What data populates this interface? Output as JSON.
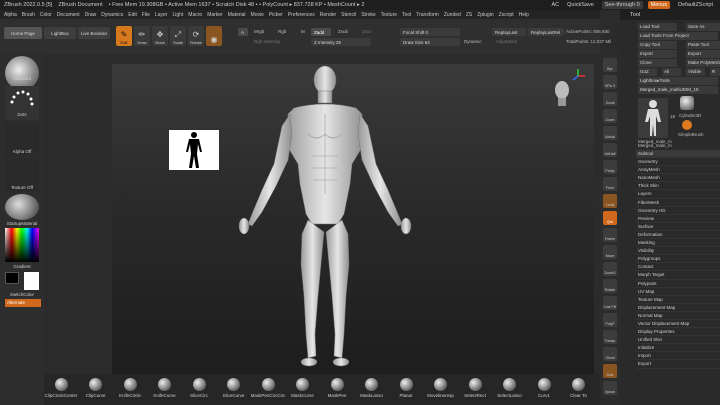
{
  "titlebar": {
    "app": "ZBrush 2022.0.5 [5]",
    "document": "ZBrush Document",
    "stats": "• Free Mem 19.308GB • Active Mem 1637 • Scratch Disk 48 • • PolyCount ▸ 837.728 KP • MeshCount ▸ 2",
    "ac": "AC",
    "quicksave": "QuickSave",
    "seethrough": "See-through   0",
    "menus": "Menus",
    "script": "DefaultZScript"
  },
  "menubar": [
    "Alpha",
    "Brush",
    "Color",
    "Document",
    "Draw",
    "Dynamics",
    "Edit",
    "File",
    "Layer",
    "Light",
    "Macro",
    "Marker",
    "Material",
    "Movie",
    "Picker",
    "Preferences",
    "Render",
    "Stencil",
    "Stroke",
    "Texture",
    "Tool",
    "Transform",
    "Zunded",
    "ZS",
    "Zplugin",
    "Zscript",
    "Help"
  ],
  "shelf": {
    "home": "Home Page",
    "lightbox": "LightBox",
    "livebool": "Live Boolean",
    "tools": [
      {
        "label": "Edit",
        "icon": "✎",
        "active": true
      },
      {
        "label": "Draw",
        "icon": "✏",
        "active": false
      },
      {
        "label": "Move",
        "icon": "✥",
        "active": false
      },
      {
        "label": "Scale",
        "icon": "⤢",
        "active": false
      },
      {
        "label": "Rotate",
        "icon": "⟳",
        "active": false
      }
    ],
    "a_label": "A",
    "mrgb": "Mrgb",
    "rgb": "Rgb",
    "m": "M",
    "zadd": "Zadd",
    "zsub": "Zsub",
    "zcut": "Zcut",
    "rgb_intensity": "Rgb Intensity",
    "z_intensity": "Z Intensity 25",
    "focal_shift": "Focal Shift 0",
    "draw_size": "Draw Size 64",
    "dynamic": "Dynamic",
    "replay_last": "ReplayLast",
    "replay_last_rel": "ReplayLastRel",
    "active_points": "ActivePoints: 806,930",
    "total_points": "TotalPoints: 12.037 Mil",
    "adjust_size": "AdjustSize"
  },
  "left": {
    "standard": "Standard",
    "dots": "Dots",
    "alpha_off": "Alpha Off",
    "texture_off": "Texture Off",
    "startup_material": "StartupMaterial",
    "gradient": "Gradient",
    "switch_color": "SwitchColor",
    "alternate": "Alternate"
  },
  "brushes": [
    "ClipCircleCenter",
    "ClipCurve",
    "KnifeCircle",
    "KnifeCurve",
    "SliceCirc",
    "SliceCurve",
    "MaskPenCircCirc",
    "MaskCurve",
    "MaskPen",
    "MaskLasso",
    "Planar",
    "Movelineresp",
    "SelectRect",
    "SelectLasso",
    "Curv1",
    "Clear To"
  ],
  "rstrip": [
    "Bpr",
    "SPix 3",
    "Scroll",
    "Zoom",
    "Actual",
    "AAHalf",
    "Persp",
    "Floor",
    "Local",
    "Qsz",
    "Frame",
    "Move",
    "ZoomD",
    "Rotate",
    "Line Fill",
    "PolyF",
    "Transp",
    "Ghost",
    "Solo",
    "Xpose"
  ],
  "palette": {
    "title": "Tool",
    "buttons": [
      [
        "Load Tool",
        "Save As"
      ],
      [
        "Load Tools From Project"
      ],
      [
        "Copy Tool",
        "Paste Tool"
      ],
      [
        "Import",
        "Export"
      ],
      [
        "Clone",
        "Make PolyMesh3D"
      ],
      [
        "GoZ",
        "All",
        "Visible",
        "R"
      ],
      [
        "Lightbox▸Tools"
      ],
      [
        "Merged_male_multiUDIM_18"
      ]
    ],
    "thumbs": [
      "Merged_male_m",
      "Cylinder3D",
      "SimpleBrush",
      "Merged_male_m"
    ],
    "thumb_count": "18",
    "items": [
      "Subtool",
      "Geometry",
      "ArrayMesh",
      "NanoMesh",
      "Thick Skin",
      "Layers",
      "FiberMesh",
      "Geometry HD",
      "Preview",
      "Surface",
      "Deformation",
      "Masking",
      "Visibility",
      "Polygroups",
      "Contact",
      "Morph Target",
      "Polypaint",
      "UV Map",
      "Texture Map",
      "Displacement Map",
      "Normal Map",
      "Vector Displacement Map",
      "Display Properties",
      "Unified Skin",
      "Initialize",
      "Import",
      "Export"
    ]
  },
  "colors": {
    "accent": "#d0691e",
    "bg": "#2b2b2b"
  }
}
